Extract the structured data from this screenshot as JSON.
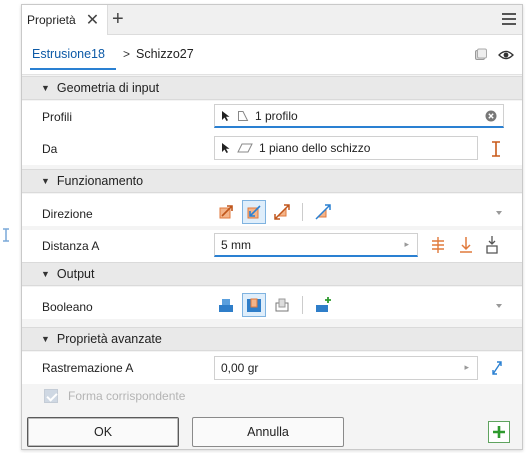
{
  "tabbar": {
    "tab_label": "Proprietà",
    "close_glyph": "✕",
    "add_glyph": "+"
  },
  "breadcrumb": {
    "parent": "Estrusione18",
    "separator": ">",
    "current": "Schizzo27"
  },
  "sections": {
    "input_geometry": "Geometria di input",
    "behavior": "Funzionamento",
    "output": "Output",
    "advanced": "Proprietà avanzate"
  },
  "fields": {
    "profiles": {
      "label": "Profili",
      "value": "1 profilo"
    },
    "from": {
      "label": "Da",
      "value": "1 piano dello schizzo"
    },
    "direction": {
      "label": "Direzione"
    },
    "distance_a": {
      "label": "Distanza A",
      "value": "5 mm"
    },
    "boolean": {
      "label": "Booleano"
    },
    "taper_a": {
      "label": "Rastremazione A",
      "value": "0,00 gr"
    },
    "match_shape": {
      "label": "Forma corrispondente",
      "checked": true,
      "enabled": false
    }
  },
  "footer": {
    "ok_label": "OK",
    "cancel_label": "Annulla"
  },
  "colors": {
    "accent_blue": "#2a80d2",
    "link_blue": "#0d5aa7",
    "orange": "#e07a3c",
    "boolean_blue": "#2f7ec9",
    "green": "#2e9a2e"
  },
  "icons": {
    "tab_close": "close-icon",
    "tab_add": "plus-icon",
    "panel_menu": "hamburger-menu-icon",
    "sketch_visibility": "square-icon",
    "eye": "eye-icon",
    "profile_select": "cursor-arrow-icon",
    "clear_selection": "clear-circle-icon",
    "flip": "flip-icon"
  }
}
